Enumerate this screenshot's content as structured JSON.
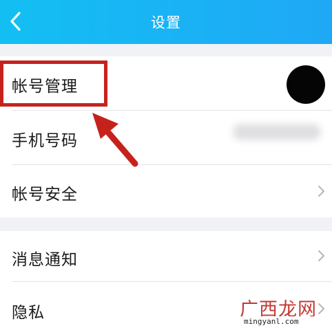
{
  "header": {
    "title": "设置",
    "back_icon": "chevron-left-icon",
    "background": "#1ab2f5"
  },
  "groups": [
    {
      "items": [
        {
          "label": "帐号管理",
          "trailing": "avatar"
        },
        {
          "label": "手机号码",
          "trailing": "blurred-phone"
        },
        {
          "label": "帐号安全",
          "trailing": "chevron-right-icon"
        }
      ]
    },
    {
      "items": [
        {
          "label": "消息通知",
          "trailing": "chevron-right-icon"
        },
        {
          "label": "隐私",
          "trailing": "chevron-right-icon"
        }
      ]
    }
  ],
  "annotation": {
    "highlight_color": "#c6221c"
  },
  "watermark": {
    "text": "广西龙网",
    "url": "mingyanl.com"
  }
}
